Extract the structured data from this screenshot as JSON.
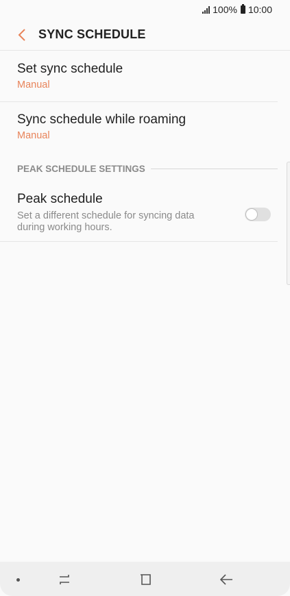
{
  "status_bar": {
    "battery_percent": "100%",
    "time": "10:00"
  },
  "header": {
    "title": "SYNC SCHEDULE"
  },
  "settings": {
    "set_sync_schedule": {
      "title": "Set sync schedule",
      "value": "Manual"
    },
    "roaming": {
      "title": "Sync schedule while roaming",
      "value": "Manual"
    },
    "section_label": "PEAK SCHEDULE SETTINGS",
    "peak": {
      "title": "Peak schedule",
      "description": "Set a different schedule for syncing data during working hours.",
      "enabled": false
    }
  },
  "colors": {
    "accent": "#e8845a",
    "background": "#fafafa"
  }
}
